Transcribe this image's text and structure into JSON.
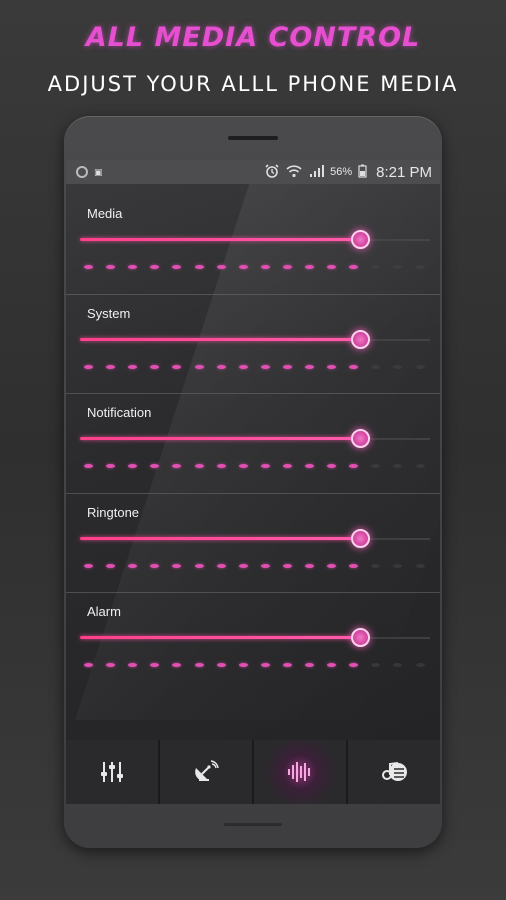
{
  "promo": {
    "title": "ALL MEDIA CONTROL",
    "subtitle": "ADJUST YOUR ALLL PHONE MEDIA"
  },
  "status_bar": {
    "battery": "56%",
    "time": "8:21 PM"
  },
  "sections": [
    {
      "label": "Media",
      "level": 0.8
    },
    {
      "label": "System",
      "level": 0.8
    },
    {
      "label": "Notification",
      "level": 0.8
    },
    {
      "label": "Ringtone",
      "level": 0.8
    },
    {
      "label": "Alarm",
      "level": 0.8
    }
  ],
  "dots": {
    "active": 13,
    "total": 16
  },
  "tabs": [
    {
      "icon": "equalizer-icon",
      "active": false
    },
    {
      "icon": "satellite-dish-icon",
      "active": false
    },
    {
      "icon": "sound-wave-icon",
      "active": true
    },
    {
      "icon": "music-note-icon",
      "active": false
    }
  ],
  "colors": {
    "accent": "#e64fd0",
    "slider": "#ff4e9e",
    "thumb": "#d94fa8"
  }
}
